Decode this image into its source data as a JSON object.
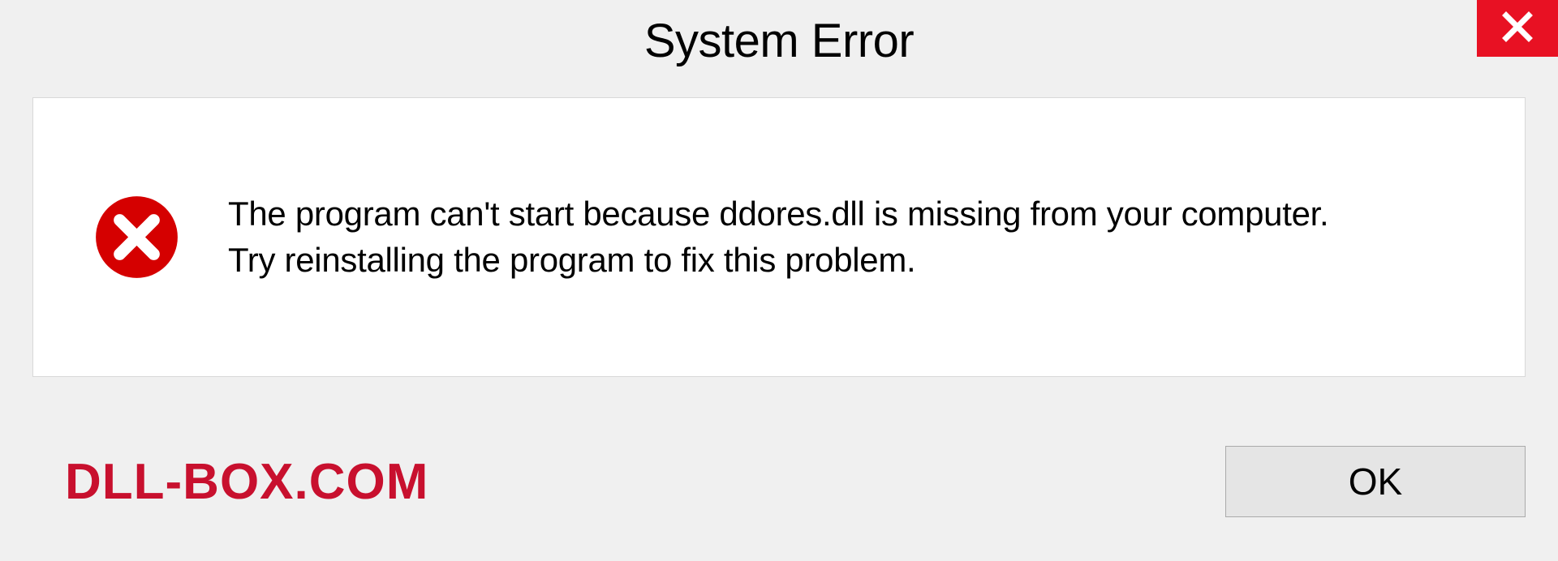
{
  "title": "System Error",
  "message_line1": "The program can't start because ddores.dll is missing from your computer.",
  "message_line2": "Try reinstalling the program to fix this problem.",
  "ok_label": "OK",
  "watermark": "DLL-BOX.COM",
  "colors": {
    "close_button": "#e81123",
    "error_icon": "#d50000",
    "watermark": "#c8102e"
  }
}
